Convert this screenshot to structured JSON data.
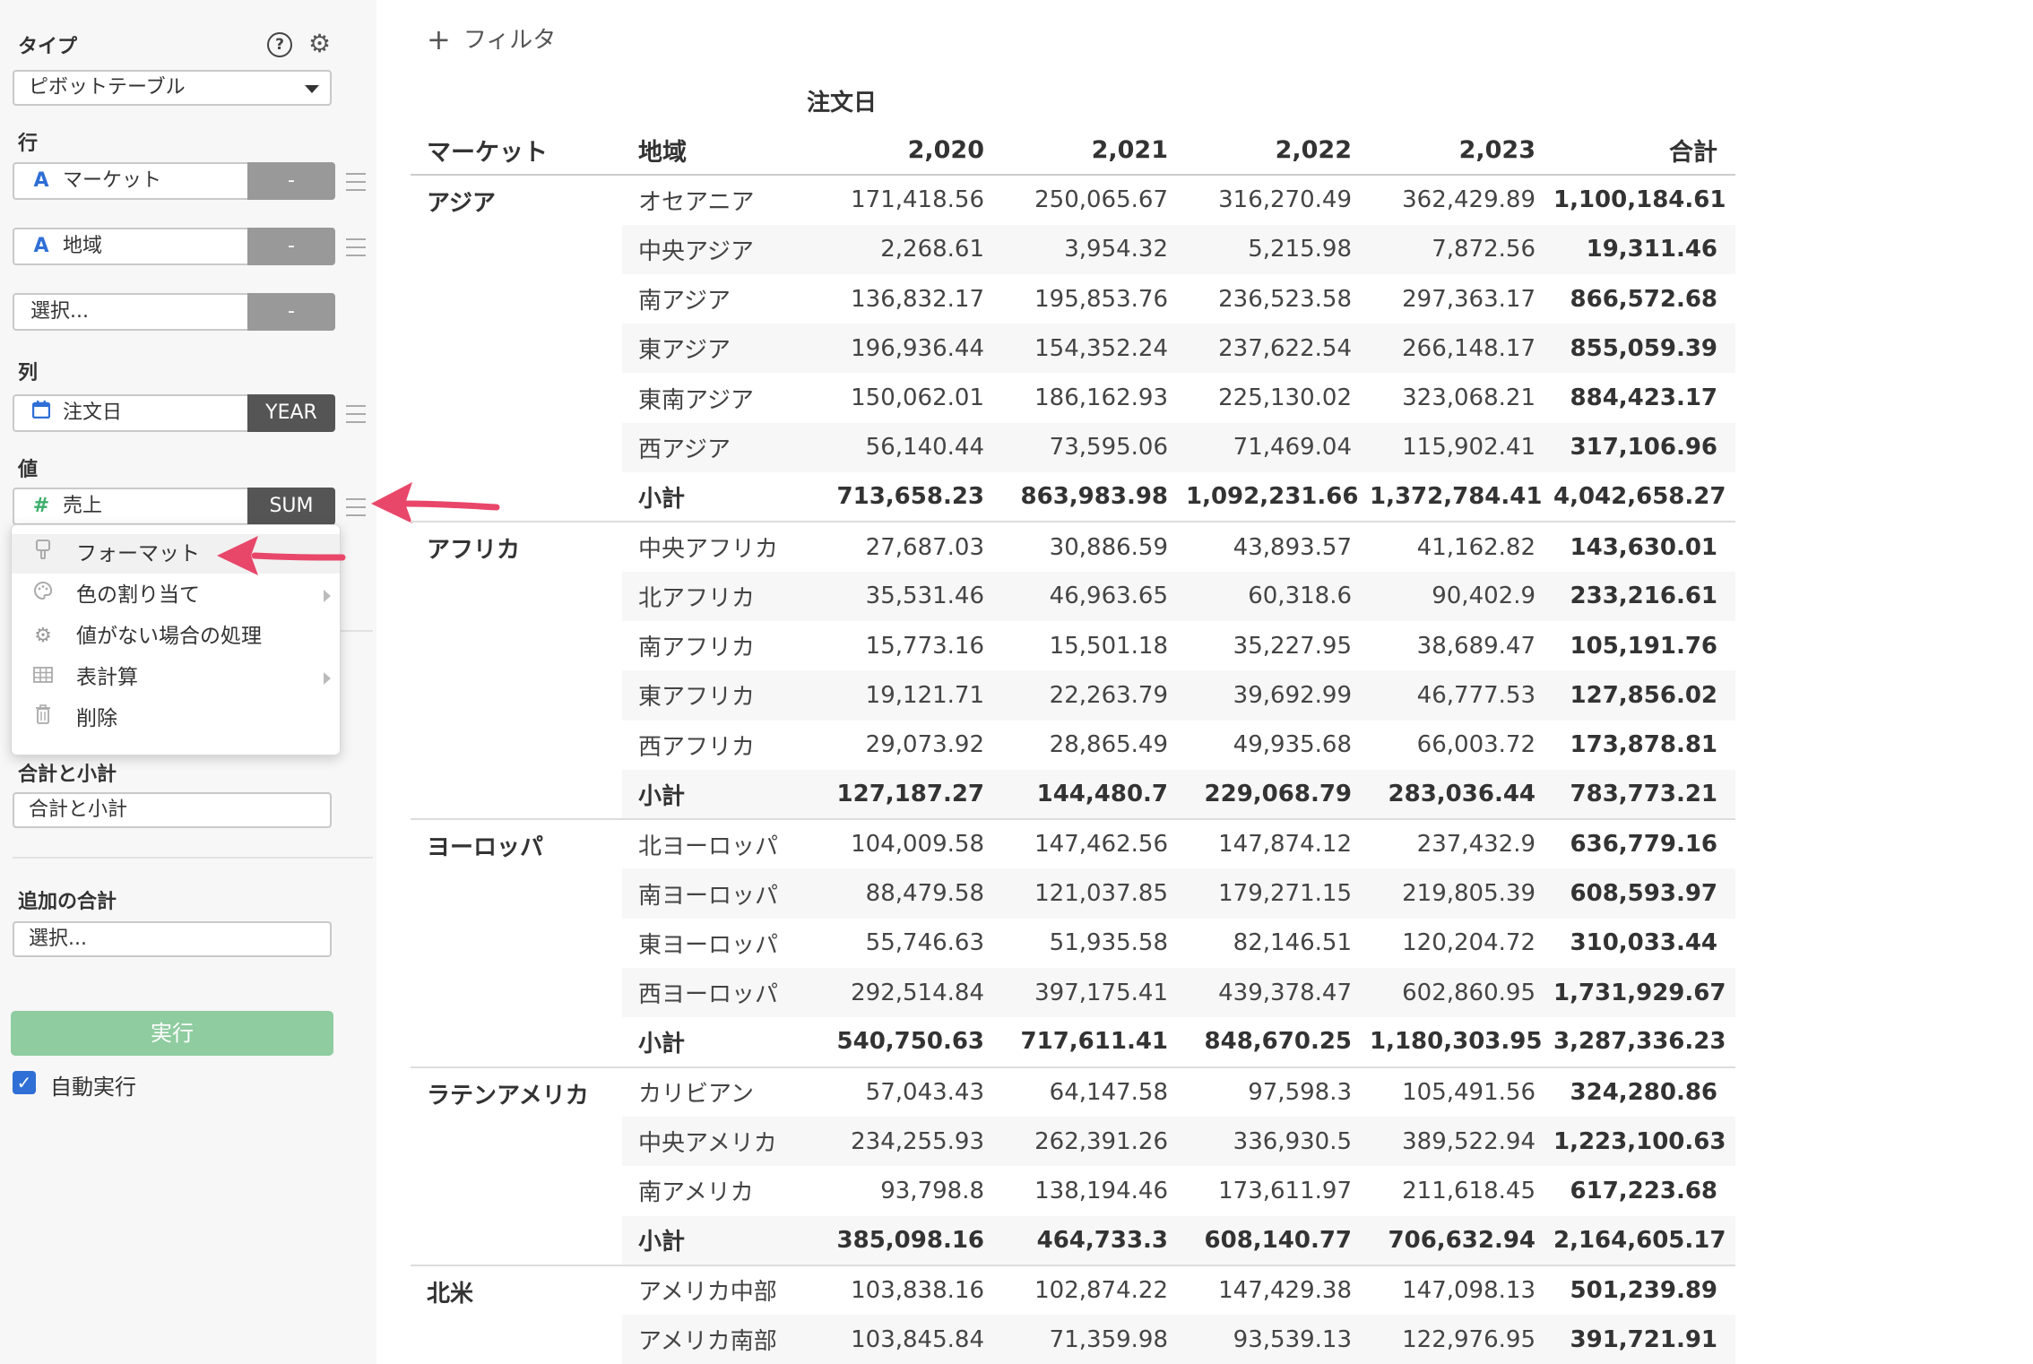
{
  "sidebar": {
    "type_label": "タイプ",
    "help_icon": "?",
    "gear_icon": "⚙",
    "type_select": "ピボットテーブル",
    "row_label": "行",
    "row_fields": [
      {
        "icon": "A",
        "name": "マーケット",
        "agg": "-"
      },
      {
        "icon": "A",
        "name": "地域",
        "agg": "-"
      },
      {
        "icon": "",
        "name": "選択...",
        "agg": "-"
      }
    ],
    "col_label": "列",
    "col_field": {
      "icon": "calendar-icon",
      "name": "注文日",
      "agg": "YEAR"
    },
    "val_label": "値",
    "val_field": {
      "icon": "#",
      "name": "売上",
      "agg": "SUM"
    },
    "totals_label": "合計と小計",
    "totals_select": "合計と小計",
    "extra_label": "追加の合計",
    "extra_select": "選択...",
    "run_label": "実行",
    "auto_label": "自動実行",
    "auto_checked": true
  },
  "menu": {
    "items": [
      {
        "icon": "brush-icon",
        "label": "フォーマット",
        "submenu": false
      },
      {
        "icon": "palette-icon",
        "label": "色の割り当て",
        "submenu": true
      },
      {
        "icon": "gear-icon",
        "label": "値がない場合の処理",
        "submenu": false
      },
      {
        "icon": "table-icon",
        "label": "表計算",
        "submenu": true
      },
      {
        "icon": "trash-icon",
        "label": "削除",
        "submenu": false
      }
    ]
  },
  "main": {
    "filter_label": "フィルタ",
    "column_group_label": "注文日",
    "headers": [
      "マーケット",
      "地域",
      "2,020",
      "2,021",
      "2,022",
      "2,023",
      "合計"
    ],
    "groups": [
      {
        "market": "アジア",
        "rows": [
          [
            "オセアニア",
            "171,418.56",
            "250,065.67",
            "316,270.49",
            "362,429.89",
            "1,100,184.61"
          ],
          [
            "中央アジア",
            "2,268.61",
            "3,954.32",
            "5,215.98",
            "7,872.56",
            "19,311.46"
          ],
          [
            "南アジア",
            "136,832.17",
            "195,853.76",
            "236,523.58",
            "297,363.17",
            "866,572.68"
          ],
          [
            "東アジア",
            "196,936.44",
            "154,352.24",
            "237,622.54",
            "266,148.17",
            "855,059.39"
          ],
          [
            "東南アジア",
            "150,062.01",
            "186,162.93",
            "225,130.02",
            "323,068.21",
            "884,423.17"
          ],
          [
            "西アジア",
            "56,140.44",
            "73,595.06",
            "71,469.04",
            "115,902.41",
            "317,106.96"
          ]
        ],
        "subtotal": [
          "小計",
          "713,658.23",
          "863,983.98",
          "1,092,231.66",
          "1,372,784.41",
          "4,042,658.27"
        ]
      },
      {
        "market": "アフリカ",
        "rows": [
          [
            "中央アフリカ",
            "27,687.03",
            "30,886.59",
            "43,893.57",
            "41,162.82",
            "143,630.01"
          ],
          [
            "北アフリカ",
            "35,531.46",
            "46,963.65",
            "60,318.6",
            "90,402.9",
            "233,216.61"
          ],
          [
            "南アフリカ",
            "15,773.16",
            "15,501.18",
            "35,227.95",
            "38,689.47",
            "105,191.76"
          ],
          [
            "東アフリカ",
            "19,121.71",
            "22,263.79",
            "39,692.99",
            "46,777.53",
            "127,856.02"
          ],
          [
            "西アフリカ",
            "29,073.92",
            "28,865.49",
            "49,935.68",
            "66,003.72",
            "173,878.81"
          ]
        ],
        "subtotal": [
          "小計",
          "127,187.27",
          "144,480.7",
          "229,068.79",
          "283,036.44",
          "783,773.21"
        ]
      },
      {
        "market": "ヨーロッパ",
        "rows": [
          [
            "北ヨーロッパ",
            "104,009.58",
            "147,462.56",
            "147,874.12",
            "237,432.9",
            "636,779.16"
          ],
          [
            "南ヨーロッパ",
            "88,479.58",
            "121,037.85",
            "179,271.15",
            "219,805.39",
            "608,593.97"
          ],
          [
            "東ヨーロッパ",
            "55,746.63",
            "51,935.58",
            "82,146.51",
            "120,204.72",
            "310,033.44"
          ],
          [
            "西ヨーロッパ",
            "292,514.84",
            "397,175.41",
            "439,378.47",
            "602,860.95",
            "1,731,929.67"
          ]
        ],
        "subtotal": [
          "小計",
          "540,750.63",
          "717,611.41",
          "848,670.25",
          "1,180,303.95",
          "3,287,336.23"
        ]
      },
      {
        "market": "ラテンアメリカ",
        "rows": [
          [
            "カリビアン",
            "57,043.43",
            "64,147.58",
            "97,598.3",
            "105,491.56",
            "324,280.86"
          ],
          [
            "中央アメリカ",
            "234,255.93",
            "262,391.26",
            "336,930.5",
            "389,522.94",
            "1,223,100.63"
          ],
          [
            "南アメリカ",
            "93,798.8",
            "138,194.46",
            "173,611.97",
            "211,618.45",
            "617,223.68"
          ]
        ],
        "subtotal": [
          "小計",
          "385,098.16",
          "464,733.3",
          "608,140.77",
          "706,632.94",
          "2,164,605.17"
        ]
      },
      {
        "market": "北米",
        "rows": [
          [
            "アメリカ中部",
            "103,838.16",
            "102,874.22",
            "147,429.38",
            "147,098.13",
            "501,239.89"
          ],
          [
            "アメリカ南部",
            "103,845.84",
            "71,359.98",
            "93,539.13",
            "122,976.95",
            "391,721.91"
          ]
        ],
        "subtotal": null
      }
    ]
  },
  "colors": {
    "accent_green": "#8fcca0",
    "arrow_pink": "#e8476a",
    "checkbox_blue": "#2f6fd6"
  }
}
